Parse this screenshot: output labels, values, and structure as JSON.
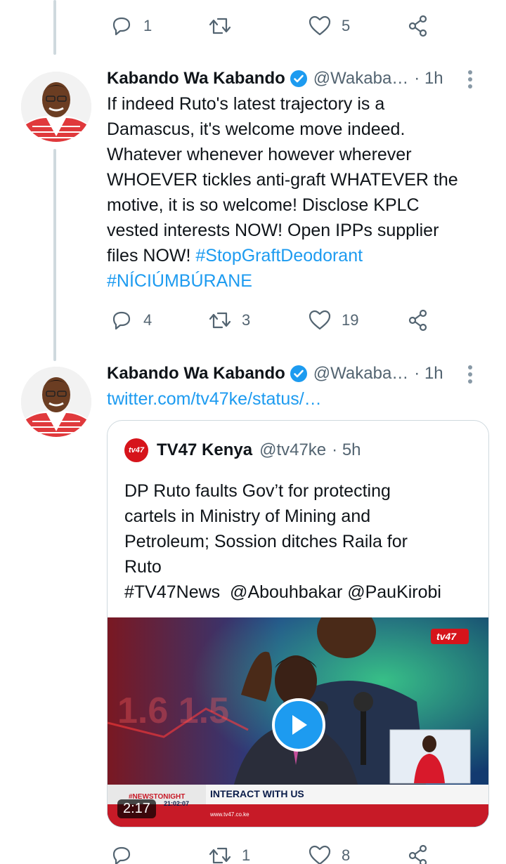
{
  "top_actions": {
    "reply_count": "1",
    "retweet_count": "",
    "like_count": "5"
  },
  "tweet1": {
    "author_name": "Kabando Wa Kabando",
    "handle": "@Wakaba…",
    "time": "· 1h",
    "text_lines": [
      "If indeed Ruto's latest trajectory is a",
      "Damascus, it's welcome move indeed.",
      "Whatever whenever however wherever",
      "WHOEVER tickles anti-graft WHATEVER the",
      "motive, it is so welcome! Disclose KPLC",
      "vested interests NOW!  Open IPPs supplier"
    ],
    "text_line7_prefix": "files NOW! ",
    "hashtag1": "#StopGraftDeodorant",
    "hashtag2": "#NÍCIÚMBÚRANE",
    "reply_count": "4",
    "retweet_count": "3",
    "like_count": "19"
  },
  "tweet2": {
    "author_name": "Kabando Wa Kabando",
    "handle": "@Wakaba…",
    "time": "· 1h",
    "link": "twitter.com/tv47ke/status/…",
    "quote": {
      "logo_text": "tv47",
      "name": "TV47 Kenya",
      "handle": "@tv47ke",
      "time": "· 5h",
      "text_lines": [
        "DP Ruto faults Gov’t for protecting",
        "cartels in Ministry of Mining and",
        "Petroleum; Sossion ditches Raila for",
        "Ruto",
        "#TV47News  @Abouhbakar @PauKirobi"
      ],
      "video": {
        "duration": "2:17",
        "channel_logo": "tv47",
        "ticker_left": "#NEWSTONIGHT",
        "ticker_time": "21:02:07",
        "ticker_main": "INTERACT WITH US",
        "ticker_url": "www.tv47.co.ke",
        "bg_numbers": "1.6  1.5"
      }
    },
    "reply_count": "",
    "retweet_count": "1",
    "like_count": "8"
  },
  "colors": {
    "link": "#1d9bf0",
    "verified": "#1d9bf0",
    "icon_gray": "#536471",
    "thread_line": "#cfd9de",
    "tv47_red": "#d6141b"
  }
}
